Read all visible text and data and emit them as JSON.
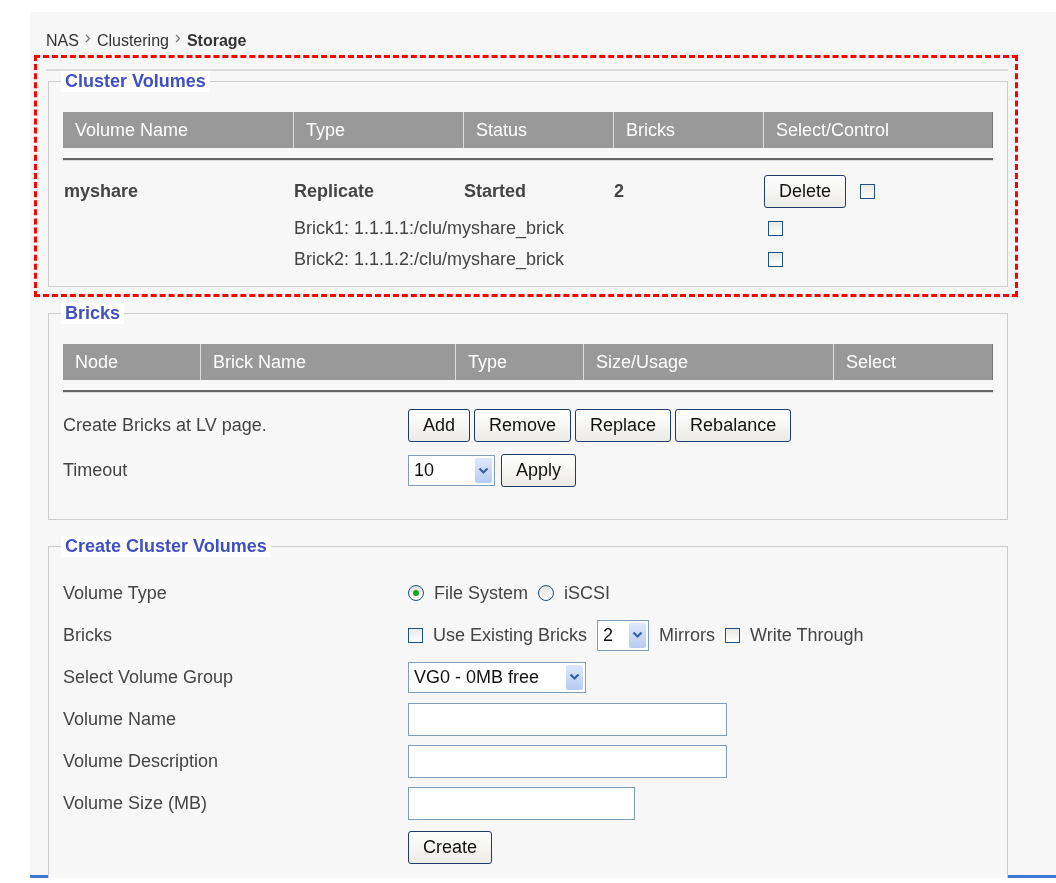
{
  "breadcrumb": [
    {
      "label": "NAS",
      "current": false
    },
    {
      "label": "Clustering",
      "current": false
    },
    {
      "label": "Storage",
      "current": true
    }
  ],
  "cluster_volumes": {
    "title": "Cluster Volumes",
    "highlighted": true,
    "columns": [
      "Volume Name",
      "Type",
      "Status",
      "Bricks",
      "Select/Control"
    ],
    "volumes": [
      {
        "name": "myshare",
        "type": "Replicate",
        "status": "Started",
        "bricks": "2",
        "action": "Delete",
        "checked": false,
        "brick_list": [
          {
            "label": "Brick1: 1.1.1.1:/clu/myshare_brick",
            "checked": false
          },
          {
            "label": "Brick2: 1.1.1.2:/clu/myshare_brick",
            "checked": false
          }
        ]
      }
    ]
  },
  "bricks": {
    "title": "Bricks",
    "columns": [
      "Node",
      "Brick Name",
      "Type",
      "Size/Usage",
      "Select"
    ],
    "note": "Create Bricks at LV page.",
    "buttons": [
      "Add",
      "Remove",
      "Replace",
      "Rebalance"
    ],
    "timeout": {
      "label": "Timeout",
      "value": "10",
      "button": "Apply"
    }
  },
  "create_cluster_volumes": {
    "title": "Create Cluster Volumes",
    "fields": [
      {
        "kind": "radio",
        "label": "Volume Type",
        "options": [
          {
            "label": "File System",
            "selected": true
          },
          {
            "label": "iSCSI",
            "selected": false
          }
        ]
      },
      {
        "kind": "bricks",
        "label": "Bricks",
        "use_existing": {
          "label": "Use Existing Bricks",
          "checked": false
        },
        "mirrors": {
          "value": "2",
          "label": "Mirrors"
        },
        "write_through": {
          "label": "Write Through",
          "checked": false
        }
      },
      {
        "kind": "select",
        "label": "Select Volume Group",
        "value": "VG0 - 0MB free"
      },
      {
        "kind": "text",
        "label": "Volume Name"
      },
      {
        "kind": "text",
        "label": "Volume Description"
      },
      {
        "kind": "short-text",
        "label": "Volume Size (MB)"
      }
    ],
    "button": "Create"
  }
}
